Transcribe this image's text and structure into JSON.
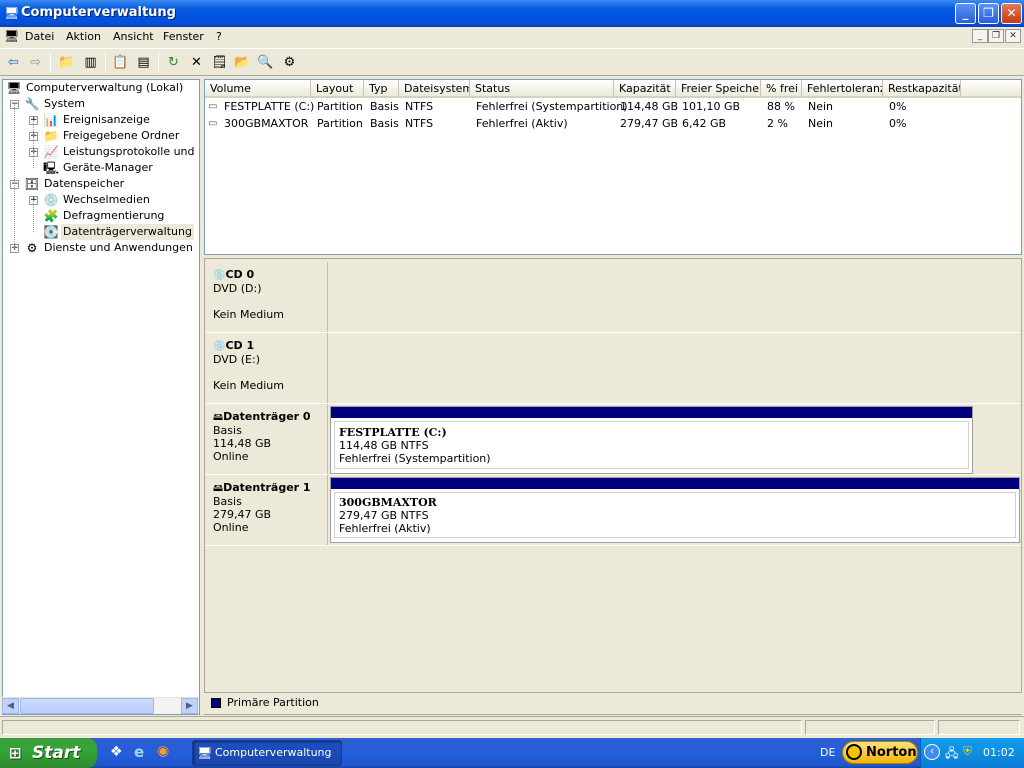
{
  "window": {
    "title": "Computerverwaltung"
  },
  "menu": [
    "Datei",
    "Aktion",
    "Ansicht",
    "Fenster",
    "?"
  ],
  "tree": [
    {
      "label": "Computerverwaltung (Lokal)",
      "icon": "computer-icon"
    },
    {
      "label": "System",
      "icon": "system-tools-icon"
    },
    {
      "label": "Ereignisanzeige",
      "icon": "event-viewer-icon"
    },
    {
      "label": "Freigegebene Ordner",
      "icon": "shared-folder-icon"
    },
    {
      "label": "Leistungsprotokolle und Warnungen",
      "icon": "performance-log-icon"
    },
    {
      "label": "Geräte-Manager",
      "icon": "device-manager-icon"
    },
    {
      "label": "Datenspeicher",
      "icon": "storage-icon"
    },
    {
      "label": "Wechselmedien",
      "icon": "removable-storage-icon"
    },
    {
      "label": "Defragmentierung",
      "icon": "defrag-icon"
    },
    {
      "label": "Datenträgerverwaltung",
      "icon": "disk-management-icon"
    },
    {
      "label": "Dienste und Anwendungen",
      "icon": "services-icon"
    }
  ],
  "list": {
    "columns": [
      "Volume",
      "Layout",
      "Typ",
      "Dateisystem",
      "Status",
      "Kapazität",
      "Freier Speicher",
      "% frei",
      "Fehlertoleranz",
      "Restkapazität"
    ],
    "rows": [
      [
        "FESTPLATTE (C:)",
        "Partition",
        "Basis",
        "NTFS",
        "Fehlerfrei (Systempartition)",
        "114,48 GB",
        "101,10 GB",
        "88 %",
        "Nein",
        "0%"
      ],
      [
        "300GBMAXTOR",
        "Partition",
        "Basis",
        "NTFS",
        "Fehlerfrei (Aktiv)",
        "279,47 GB",
        "6,42 GB",
        "2 %",
        "Nein",
        "0%"
      ]
    ]
  },
  "disks": [
    {
      "name": "CD 0",
      "line1": "DVD (D:)",
      "line2": "",
      "line3": "Kein Medium",
      "icon": "cd-drive-icon"
    },
    {
      "name": "CD 1",
      "line1": "DVD (E:)",
      "line2": "",
      "line3": "Kein Medium",
      "icon": "cd-drive-icon"
    },
    {
      "name": "Datenträger 0",
      "line1": "Basis",
      "line2": "114,48 GB",
      "line3": "Online",
      "icon": "hard-disk-icon",
      "partition": {
        "title": "FESTPLATTE  (C:)",
        "size": "114,48 GB NTFS",
        "status": "Fehlerfrei (Systempartition)"
      }
    },
    {
      "name": "Datenträger 1",
      "line1": "Basis",
      "line2": "279,47 GB",
      "line3": "Online",
      "icon": "hard-disk-icon",
      "partition": {
        "title": "300GBMAXTOR",
        "size": "279,47 GB NTFS",
        "status": "Fehlerfrei (Aktiv)"
      }
    }
  ],
  "legend": {
    "label": "Primäre Partition",
    "color": "#00007f"
  },
  "taskbar": {
    "start": "Start",
    "task": "Computerverwaltung",
    "lang": "DE",
    "norton": "Norton",
    "clock": "01:02"
  }
}
